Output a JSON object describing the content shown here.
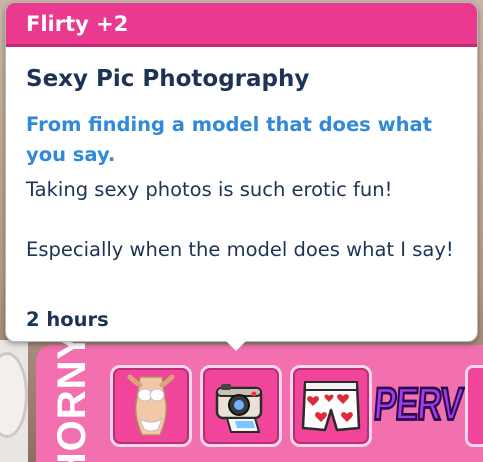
{
  "tooltip": {
    "header": "Flirty +2",
    "title": "Sexy Pic Photography",
    "cause": "From finding a model that does what you say.",
    "description": [
      "Taking sexy photos is such erotic fun!",
      "Especially when the model does what I say!"
    ],
    "duration": "2 hours"
  },
  "moodlet_bar": {
    "label": "HORNY",
    "items": [
      {
        "name": "lingerie-body-icon"
      },
      {
        "name": "camera-icon"
      },
      {
        "name": "heart-boxers-icon"
      },
      {
        "name": "perv-badge",
        "text": "PERV"
      }
    ]
  },
  "colors": {
    "header_pink": "#ea3a8f",
    "title_navy": "#1d3355",
    "cause_blue": "#3189d8",
    "slot_pink": "#f0459a",
    "perv_purple": "#a13af0"
  }
}
